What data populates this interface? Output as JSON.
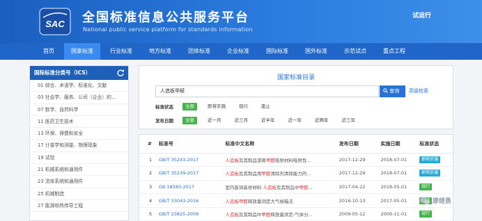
{
  "header": {
    "logo_text": "SAC",
    "title": "全国标准信息公共服务平台",
    "subtitle": "National public service platform  for standards information",
    "trial_label": "试运行"
  },
  "nav": [
    "首页",
    "国家标准",
    "行业标准",
    "地方标准",
    "团体标准",
    "企业标准",
    "国际标准",
    "国外标准",
    "示范试点",
    "重点工程"
  ],
  "nav_active_index": 1,
  "sidebar": {
    "title": "国际标准分类号（ICS）",
    "items": [
      "01 综合、术语学、标准化、文献",
      "03 社会学、服务、公司（企业）的...",
      "07 数学、自然科学",
      "11 医药卫生技术",
      "13 环保、保健和安全",
      "17 计量学和测量、物理现象",
      "19 试验",
      "21 机械系统和通用件",
      "23 流体系统和通用件",
      "25 机械制造",
      "27 能源和热传导工程"
    ]
  },
  "search": {
    "panel_title": "国家标准目录",
    "query": "人造板甲醛",
    "search_button": "查询",
    "advanced_button": "高级检索"
  },
  "filters": {
    "status_label": "标准状态",
    "status_options": [
      "全部",
      "即将实施",
      "现行",
      "废止"
    ],
    "date_label": "发布日期",
    "date_options": [
      "全部",
      "近一月",
      "近三月",
      "近半年",
      "近一年",
      "近两年",
      "近三年"
    ]
  },
  "table": {
    "headers": [
      "#",
      "标准号",
      "标准中文名称",
      "发布日期",
      "实施日期",
      "标准状态"
    ],
    "rows": [
      {
        "no": "1",
        "code": "GB/T 35243-2017",
        "name": [
          "人造板",
          "及其制品游离",
          "甲醛",
          "吸附材料吸附性..."
        ],
        "issued": "2017-12-29",
        "effective": "2018-07-01",
        "status": "即将实施",
        "status_type": "soon"
      },
      {
        "no": "2",
        "code": "GB/T 35239-2017",
        "name": [
          "人造板",
          "及其制品用",
          "甲醛",
          "清除剂清除能力的..."
        ],
        "issued": "2017-12-29",
        "effective": "2018-07-01",
        "status": "即将实施",
        "status_type": "soon"
      },
      {
        "no": "3",
        "code": "GB 18580-2017",
        "name": [
          "室内装饰装修材料 ",
          "人造板",
          "及其制品中",
          "甲醛",
          "..."
        ],
        "issued": "2017-04-22",
        "effective": "2018-05-01",
        "status": "现行",
        "status_type": "active"
      },
      {
        "no": "4",
        "code": "GB/T 33043-2016",
        "name": [
          "人造板",
          "甲醛",
          "释放量测定大气候箱法"
        ],
        "issued": "2016-10-13",
        "effective": "2017-05-01",
        "status": "现行",
        "status_type": "active"
      },
      {
        "no": "5",
        "code": "GB/T 23825-2009",
        "name": [
          "人造板",
          "及其制品中",
          "甲醛",
          "释放量测定-气体分..."
        ],
        "issued": "2009-05-12",
        "effective": "2009-11-01",
        "status": "现行",
        "status_type": "active"
      }
    ]
  },
  "watermark": "廖继勇",
  "colors": {
    "brand_blue": "#1f66c8",
    "link_blue": "#2a72d6",
    "highlight_red": "#e03434",
    "green": "#43b34a",
    "cyan": "#2aa8d8"
  }
}
